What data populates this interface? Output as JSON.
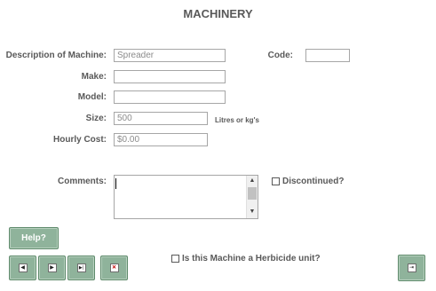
{
  "form": {
    "title": "MACHINERY",
    "description_label": "Description of Machine:",
    "description_value": "Spreader",
    "code_label": "Code:",
    "code_value": "",
    "make_label": "Make:",
    "make_value": "",
    "model_label": "Model:",
    "model_value": "",
    "size_label": "Size:",
    "size_value": "500",
    "size_unit": "Litres or kg's",
    "hourly_cost_label": "Hourly Cost:",
    "hourly_cost_value": "$0.00",
    "comments_label": "Comments:",
    "comments_value": "",
    "discontinued_label": "Discontinued?",
    "discontinued_checked": false,
    "herbicide_label": "Is this Machine a Herbicide unit?",
    "herbicide_checked": false
  },
  "buttons": {
    "help_label": "Help?",
    "first_icon": "first-record-icon",
    "next_icon": "next-record-icon",
    "last_icon": "last-record-icon",
    "delete_icon": "delete-record-icon",
    "exit_icon": "exit-icon"
  },
  "colors": {
    "button_fill": "#8fb39b",
    "label_text": "#595959",
    "field_border": "#a6a6a6"
  }
}
